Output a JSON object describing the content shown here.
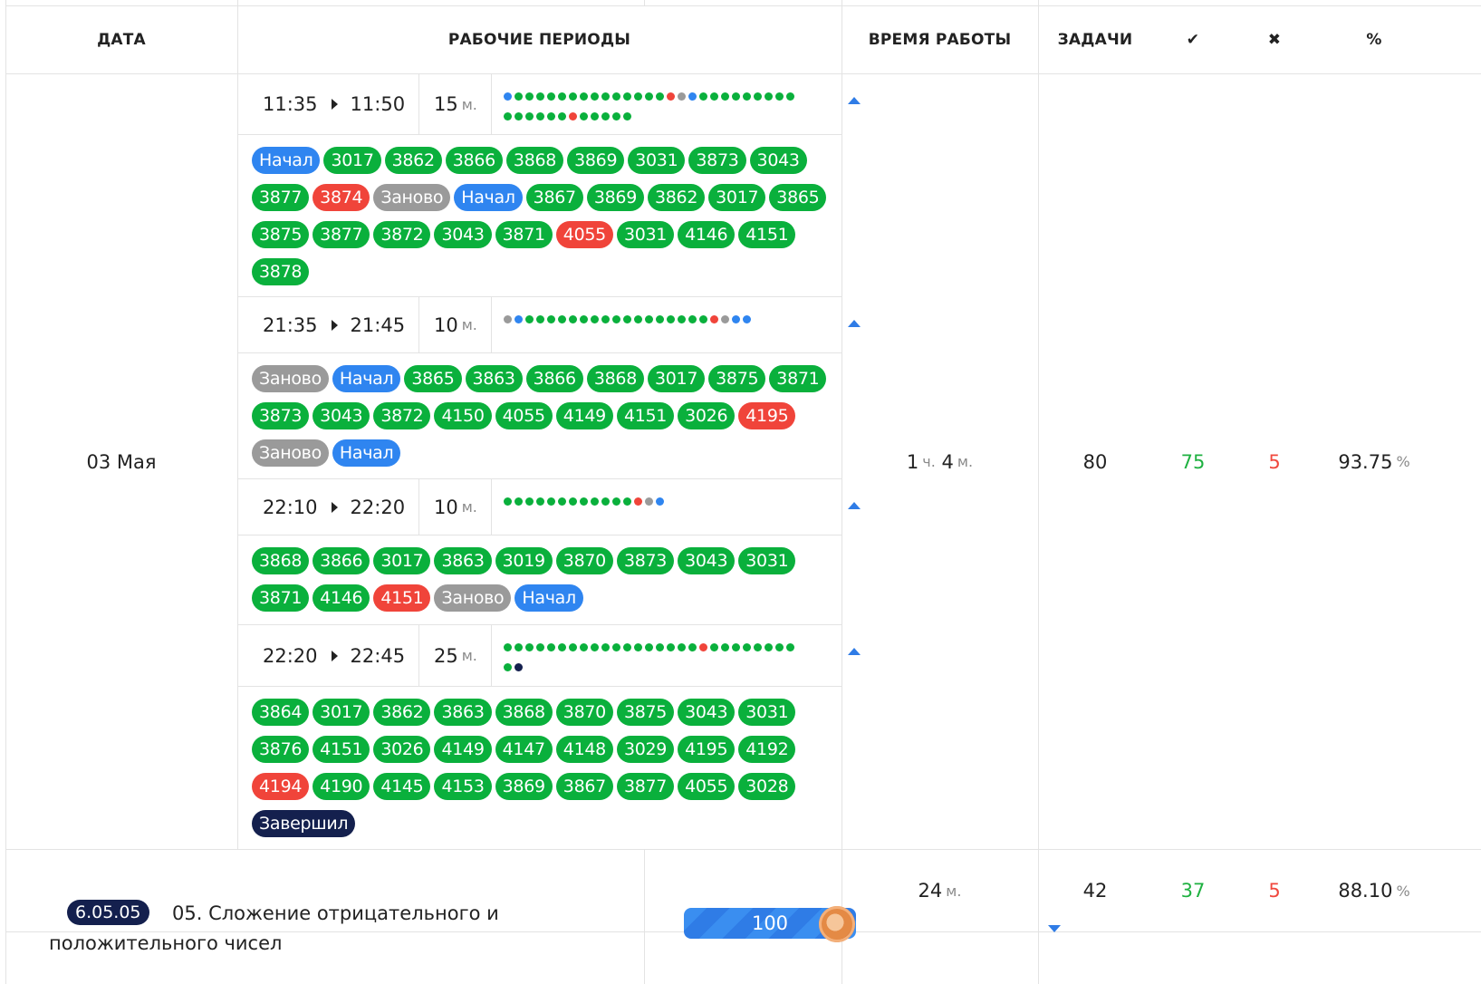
{
  "headers": {
    "date": "ДАТА",
    "periods": "РАБОЧИЕ ПЕРИОДЫ",
    "work_time": "ВРЕМЯ РАБОТЫ",
    "tasks": "ЗАДАЧИ",
    "correct": "✔",
    "wrong": "✖",
    "percent": "%"
  },
  "day": {
    "date": "03 Мая",
    "time_h": "1",
    "time_h_unit": "ч.",
    "time_m": "4",
    "time_m_unit": "м.",
    "tasks": "80",
    "correct": "75",
    "wrong": "5",
    "percent": "93.75",
    "percent_unit": "%"
  },
  "periods": [
    {
      "start": "11:35",
      "end": "11:50",
      "duration": "15",
      "duration_unit": "м.",
      "dots": [
        "blue",
        "green",
        "green",
        "green",
        "green",
        "green",
        "green",
        "green",
        "green",
        "green",
        "green",
        "green",
        "green",
        "green",
        "green",
        "red",
        "grey",
        "blue",
        "green",
        "green",
        "green",
        "green",
        "green",
        "green",
        "green",
        "green",
        "green",
        "green",
        "green",
        "green",
        "green",
        "green",
        "green",
        "red",
        "green",
        "green",
        "green",
        "green",
        "green"
      ],
      "chips": [
        {
          "text": "Начал",
          "color": "blue"
        },
        {
          "text": "3017",
          "color": "green"
        },
        {
          "text": "3862",
          "color": "green"
        },
        {
          "text": "3866",
          "color": "green"
        },
        {
          "text": "3868",
          "color": "green"
        },
        {
          "text": "3869",
          "color": "green"
        },
        {
          "text": "3031",
          "color": "green"
        },
        {
          "text": "3873",
          "color": "green"
        },
        {
          "text": "3043",
          "color": "green"
        },
        {
          "text": "3877",
          "color": "green"
        },
        {
          "text": "3874",
          "color": "red"
        },
        {
          "text": "Заново",
          "color": "grey"
        },
        {
          "text": "Начал",
          "color": "blue"
        },
        {
          "text": "3867",
          "color": "green"
        },
        {
          "text": "3869",
          "color": "green"
        },
        {
          "text": "3862",
          "color": "green"
        },
        {
          "text": "3017",
          "color": "green"
        },
        {
          "text": "3865",
          "color": "green"
        },
        {
          "text": "3875",
          "color": "green"
        },
        {
          "text": "3877",
          "color": "green"
        },
        {
          "text": "3872",
          "color": "green"
        },
        {
          "text": "3043",
          "color": "green"
        },
        {
          "text": "3871",
          "color": "green"
        },
        {
          "text": "4055",
          "color": "red"
        },
        {
          "text": "3031",
          "color": "green"
        },
        {
          "text": "4146",
          "color": "green"
        },
        {
          "text": "4151",
          "color": "green"
        },
        {
          "text": "3878",
          "color": "green"
        }
      ]
    },
    {
      "start": "21:35",
      "end": "21:45",
      "duration": "10",
      "duration_unit": "м.",
      "dots": [
        "grey",
        "blue",
        "green",
        "green",
        "green",
        "green",
        "green",
        "green",
        "green",
        "green",
        "green",
        "green",
        "green",
        "green",
        "green",
        "green",
        "green",
        "green",
        "green",
        "red",
        "grey",
        "blue",
        "blue"
      ],
      "chips": [
        {
          "text": "Заново",
          "color": "grey"
        },
        {
          "text": "Начал",
          "color": "blue"
        },
        {
          "text": "3865",
          "color": "green"
        },
        {
          "text": "3863",
          "color": "green"
        },
        {
          "text": "3866",
          "color": "green"
        },
        {
          "text": "3868",
          "color": "green"
        },
        {
          "text": "3017",
          "color": "green"
        },
        {
          "text": "3875",
          "color": "green"
        },
        {
          "text": "3871",
          "color": "green"
        },
        {
          "text": "3873",
          "color": "green"
        },
        {
          "text": "3043",
          "color": "green"
        },
        {
          "text": "3872",
          "color": "green"
        },
        {
          "text": "4150",
          "color": "green"
        },
        {
          "text": "4055",
          "color": "green"
        },
        {
          "text": "4149",
          "color": "green"
        },
        {
          "text": "4151",
          "color": "green"
        },
        {
          "text": "3026",
          "color": "green"
        },
        {
          "text": "4195",
          "color": "red"
        },
        {
          "text": "Заново",
          "color": "grey"
        },
        {
          "text": "Начал",
          "color": "blue"
        }
      ]
    },
    {
      "start": "22:10",
      "end": "22:20",
      "duration": "10",
      "duration_unit": "м.",
      "dots": [
        "green",
        "green",
        "green",
        "green",
        "green",
        "green",
        "green",
        "green",
        "green",
        "green",
        "green",
        "green",
        "red",
        "grey",
        "blue"
      ],
      "chips": [
        {
          "text": "3868",
          "color": "green"
        },
        {
          "text": "3866",
          "color": "green"
        },
        {
          "text": "3017",
          "color": "green"
        },
        {
          "text": "3863",
          "color": "green"
        },
        {
          "text": "3019",
          "color": "green"
        },
        {
          "text": "3870",
          "color": "green"
        },
        {
          "text": "3873",
          "color": "green"
        },
        {
          "text": "3043",
          "color": "green"
        },
        {
          "text": "3031",
          "color": "green"
        },
        {
          "text": "3871",
          "color": "green"
        },
        {
          "text": "4146",
          "color": "green"
        },
        {
          "text": "4151",
          "color": "red"
        },
        {
          "text": "Заново",
          "color": "grey"
        },
        {
          "text": "Начал",
          "color": "blue"
        }
      ]
    },
    {
      "start": "22:20",
      "end": "22:45",
      "duration": "25",
      "duration_unit": "м.",
      "dots": [
        "green",
        "green",
        "green",
        "green",
        "green",
        "green",
        "green",
        "green",
        "green",
        "green",
        "green",
        "green",
        "green",
        "green",
        "green",
        "green",
        "green",
        "green",
        "red",
        "green",
        "green",
        "green",
        "green",
        "green",
        "green",
        "green",
        "green",
        "green",
        "navy"
      ],
      "chips": [
        {
          "text": "3864",
          "color": "green"
        },
        {
          "text": "3017",
          "color": "green"
        },
        {
          "text": "3862",
          "color": "green"
        },
        {
          "text": "3863",
          "color": "green"
        },
        {
          "text": "3868",
          "color": "green"
        },
        {
          "text": "3870",
          "color": "green"
        },
        {
          "text": "3875",
          "color": "green"
        },
        {
          "text": "3043",
          "color": "green"
        },
        {
          "text": "3031",
          "color": "green"
        },
        {
          "text": "3876",
          "color": "green"
        },
        {
          "text": "4151",
          "color": "green"
        },
        {
          "text": "3026",
          "color": "green"
        },
        {
          "text": "4149",
          "color": "green"
        },
        {
          "text": "4147",
          "color": "green"
        },
        {
          "text": "4148",
          "color": "green"
        },
        {
          "text": "3029",
          "color": "green"
        },
        {
          "text": "4195",
          "color": "green"
        },
        {
          "text": "4192",
          "color": "green"
        },
        {
          "text": "4194",
          "color": "red"
        },
        {
          "text": "4190",
          "color": "green"
        },
        {
          "text": "4145",
          "color": "green"
        },
        {
          "text": "4153",
          "color": "green"
        },
        {
          "text": "3869",
          "color": "green"
        },
        {
          "text": "3867",
          "color": "green"
        },
        {
          "text": "3877",
          "color": "green"
        },
        {
          "text": "4055",
          "color": "green"
        },
        {
          "text": "3028",
          "color": "green"
        },
        {
          "text": "Завершил",
          "color": "navy"
        }
      ]
    }
  ],
  "lesson": {
    "badge": "6.05.05",
    "title": "05. Сложение отрицательного и положительного чисел",
    "score": "100",
    "time_m": "24",
    "time_m_unit": "м.",
    "tasks": "42",
    "correct": "37",
    "wrong": "5",
    "percent": "88.10",
    "percent_unit": "%"
  },
  "colors": {
    "green": "#0ab03c",
    "red": "#f0443a",
    "blue": "#2f85f0",
    "grey": "#9a9a9a",
    "navy": "#14204e",
    "correct_text": "#1fb141",
    "wrong_text": "#f0483e"
  }
}
